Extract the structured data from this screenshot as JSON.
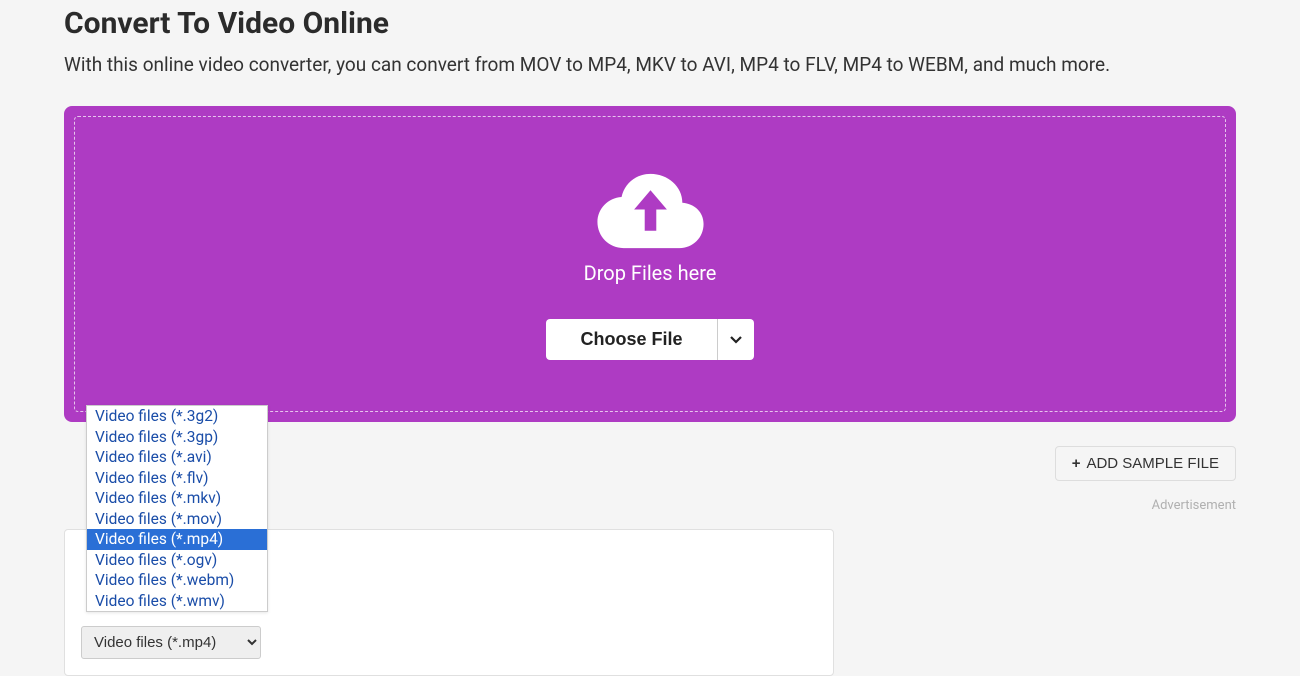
{
  "page": {
    "title": "Convert To Video Online",
    "subtitle": "With this online video converter, you can convert from MOV to MP4, MKV to AVI, MP4 to FLV, MP4 to WEBM, and much more."
  },
  "dropzone": {
    "drop_text": "Drop Files here",
    "choose_file_label": "Choose File"
  },
  "toolbar": {
    "add_sample_label": "ADD SAMPLE FILE"
  },
  "ad_label": "Advertisement",
  "format_selector": {
    "selected_value": "Video files (*.mp4)",
    "options": [
      "Video files (*.3g2)",
      "Video files (*.3gp)",
      "Video files (*.avi)",
      "Video files (*.flv)",
      "Video files (*.mkv)",
      "Video files (*.mov)",
      "Video files (*.mp4)",
      "Video files (*.ogv)",
      "Video files (*.webm)",
      "Video files (*.wmv)"
    ],
    "selected_index": 6
  }
}
